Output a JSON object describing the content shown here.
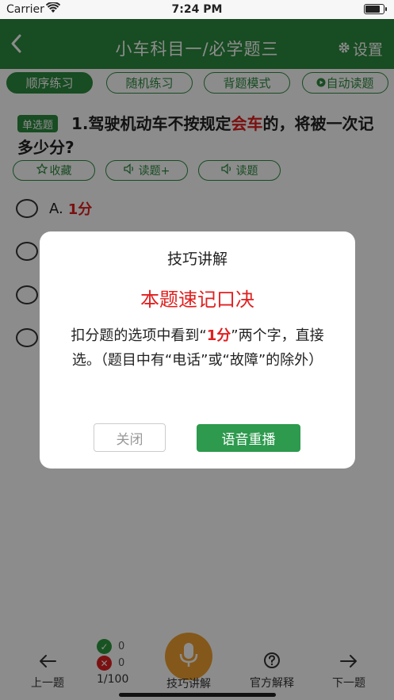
{
  "status_bar": {
    "carrier": "Carrier",
    "time": "7:24 PM"
  },
  "nav": {
    "title": "小车科目一/必学题三",
    "settings_label": "设置"
  },
  "modes": [
    "顺序练习",
    "随机练习",
    "背题模式",
    "自动读题"
  ],
  "question": {
    "type_tag": "单选题",
    "text_before": "1.驾驶机动车不按规定",
    "text_highlight": "会车",
    "text_after": "的，将被一次记多少分?"
  },
  "actions": {
    "favorite": "收藏",
    "read_plus": "读题+",
    "read": "读题"
  },
  "options": [
    {
      "label": "A.",
      "value": "1分"
    },
    {
      "label": "",
      "value": ""
    },
    {
      "label": "",
      "value": ""
    },
    {
      "label": "",
      "value": ""
    }
  ],
  "toolbar": {
    "prev": "上一题",
    "correct_count": "0",
    "wrong_count": "0",
    "progress": "1/100",
    "tips": "技巧讲解",
    "official": "官方解释",
    "next": "下一题"
  },
  "dialog": {
    "title": "技巧讲解",
    "subtitle": "本题速记口决",
    "body_before": "扣分题的选项中看到“",
    "body_highlight": "1分",
    "body_after": "”两个字，直接选。（题目中有“电话”或“故障”的除外）",
    "close_label": "关闭",
    "replay_label": "语音重播"
  },
  "colors": {
    "primary": "#2d8a3e",
    "highlight": "#e02020",
    "mic": "#f0a030"
  }
}
